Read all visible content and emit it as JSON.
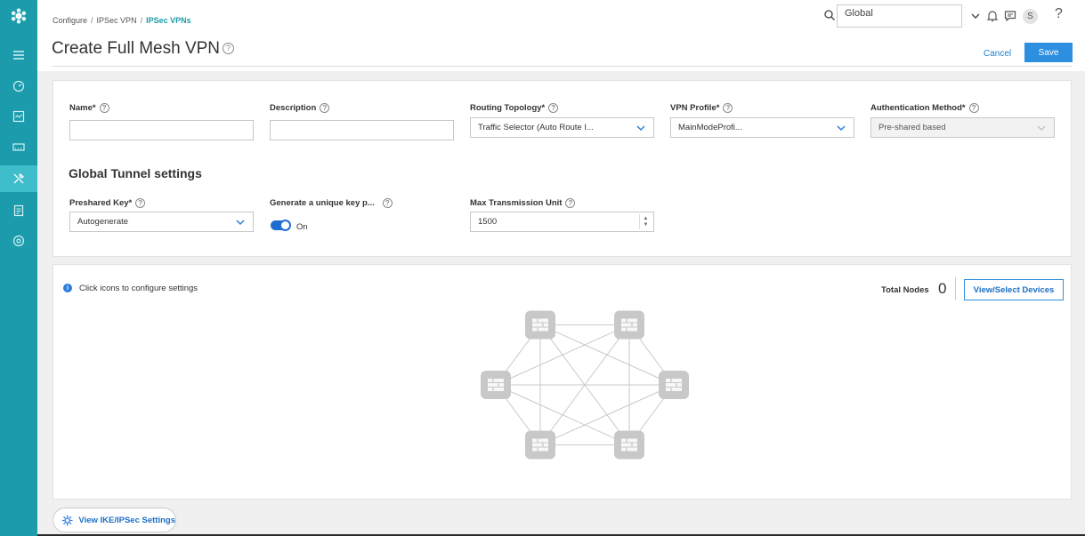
{
  "colors": {
    "sidebar": "#1b9bab",
    "accent": "#2d8fe0",
    "link": "#1b6fc6",
    "node": "#c8c8c8"
  },
  "sidebar": {
    "items": [
      {
        "name": "menu-icon",
        "active": false
      },
      {
        "name": "dashboard-icon",
        "active": false
      },
      {
        "name": "monitor-icon",
        "active": false
      },
      {
        "name": "devices-icon",
        "active": false
      },
      {
        "name": "configure-icon",
        "active": true
      },
      {
        "name": "reports-icon",
        "active": false
      },
      {
        "name": "administration-icon",
        "active": false
      }
    ]
  },
  "header": {
    "breadcrumb": [
      "Configure",
      "IPSec VPN",
      "IPSec VPNs"
    ],
    "title": "Create Full Mesh VPN",
    "scope_value": "Global",
    "avatar_initial": "S",
    "help_glyph": "?"
  },
  "actions": {
    "cancel": "Cancel",
    "save": "Save"
  },
  "form": {
    "name_label": "Name*",
    "name_value": "",
    "description_label": "Description",
    "description_value": "",
    "routing_label": "Routing Topology*",
    "routing_value": "Traffic Selector (Auto Route I...",
    "vpn_profile_label": "VPN Profile*",
    "vpn_profile_value": "MainModeProfi...",
    "auth_label": "Authentication Method*",
    "auth_value": "Pre-shared based",
    "global_tunnel_title": "Global Tunnel settings",
    "psk_label": "Preshared Key*",
    "psk_value": "Autogenerate",
    "unique_key_label": "Generate a unique key p...",
    "unique_key_state": "On",
    "mtu_label": "Max Transmission Unit",
    "mtu_value": "1500"
  },
  "topology": {
    "info_text": "Click icons to configure settings",
    "total_nodes_label": "Total Nodes",
    "total_nodes": "0",
    "view_select_devices": "View/Select Devices",
    "node_count": 6
  },
  "footer": {
    "ike_button": "View IKE/IPSec Settings"
  }
}
